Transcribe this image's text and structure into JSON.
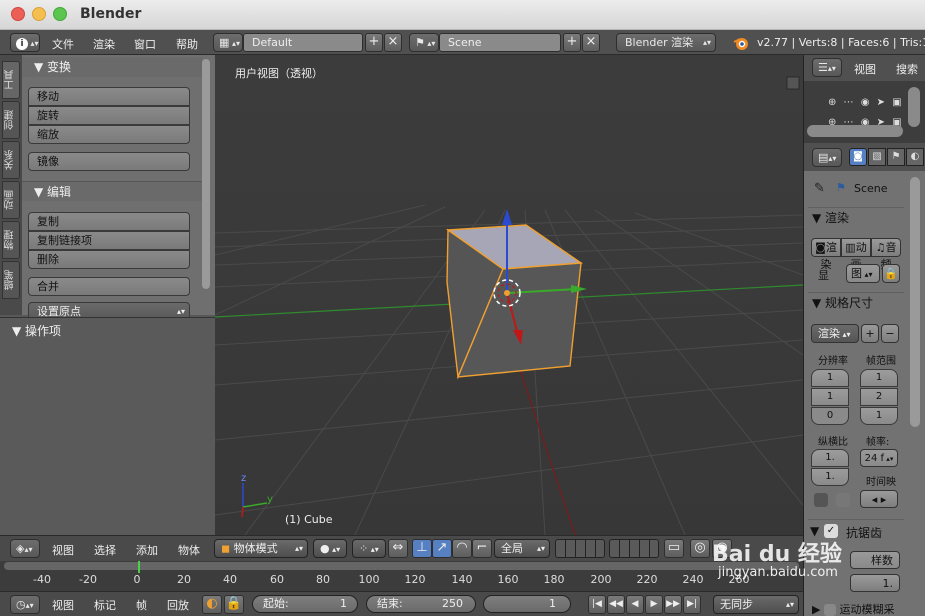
{
  "window": {
    "title": "Blender"
  },
  "info_header": {
    "menus": [
      "文件",
      "渲染",
      "窗口",
      "帮助"
    ],
    "screen_layout": "Default",
    "scene": "Scene",
    "engine": "Blender 渲染",
    "stats": "v2.77 | Verts:8 | Faces:6 | Tris:12"
  },
  "tool_tabs": [
    "工具",
    "创建",
    "关系",
    "动画",
    "物理",
    "蜡笔"
  ],
  "tool_shelf": {
    "transform": {
      "title": "▼ 变换",
      "buttons": [
        "移动",
        "旋转",
        "缩放",
        "镜像"
      ]
    },
    "edit": {
      "title": "▼ 编辑",
      "buttons": [
        "复制",
        "复制链接项",
        "删除",
        "合并"
      ]
    },
    "set_origin": "设置原点",
    "operator": "▼ 操作项"
  },
  "viewport": {
    "label": "用户视图（透视）",
    "object_label": "(1) Cube",
    "axis_y": "y",
    "axis_z": "z"
  },
  "outliner": {
    "view": "视图",
    "search": "搜索"
  },
  "properties": {
    "scene_name": "Scene",
    "render_section": "▼ 渲染",
    "render_btns": [
      "渲染",
      "动画",
      "音频"
    ],
    "display_label": "显",
    "display_value": "图",
    "dimensions_section": "▼ 规格尺寸",
    "preset": "渲染",
    "resolution_label": "分辨率",
    "frame_range_label": "帧范围",
    "res_values": [
      "1",
      "1",
      "0"
    ],
    "range_values": [
      "1",
      "2",
      "1"
    ],
    "aspect_label": "纵横比",
    "framerate_label": "帧率:",
    "aspect_values": [
      "1.",
      "1."
    ],
    "framerate": "24 f",
    "time_remap": "时间映",
    "aa_section": "抗锯齿",
    "aa_samples": "",
    "aa_filter": "样数",
    "aa_value": "1.",
    "motion_blur": "运动模糊采"
  },
  "viewport_header": {
    "menus": [
      "视图",
      "选择",
      "添加",
      "物体"
    ],
    "mode": "物体模式",
    "orientation": "全局"
  },
  "timeline": {
    "ticks": [
      "-40",
      "-20",
      "0",
      "20",
      "40",
      "60",
      "80",
      "100",
      "120",
      "140",
      "160",
      "180",
      "200",
      "220",
      "240",
      "260"
    ],
    "current_frame": "1",
    "menus": [
      "视图",
      "标记",
      "帧",
      "回放"
    ],
    "start_label": "起始:",
    "start": "1",
    "end_label": "结束:",
    "end": "250",
    "frame": "1",
    "sync": "无同步"
  },
  "watermark": {
    "brand": "Bai du 经验",
    "url": "jingyan.baidu.com"
  },
  "colors": {
    "accent": "#5680c2",
    "selected_outline": "#f0a030",
    "x_axis": "#7a1a1a",
    "y_axis": "#3aaa2a",
    "z_axis": "#2a4ad0"
  }
}
